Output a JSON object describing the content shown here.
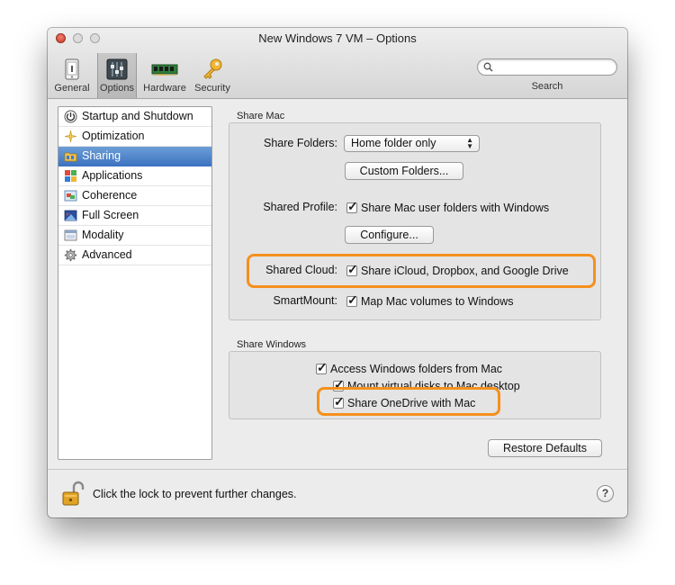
{
  "window": {
    "title": "New Windows 7 VM – Options"
  },
  "toolbar": {
    "items": [
      {
        "label": "General",
        "icon": "phone-device-icon"
      },
      {
        "label": "Options",
        "icon": "sliders-icon",
        "active": true
      },
      {
        "label": "Hardware",
        "icon": "memory-chip-icon"
      },
      {
        "label": "Security",
        "icon": "key-icon"
      }
    ],
    "search_label": "Search",
    "search_value": ""
  },
  "sidebar": {
    "items": [
      {
        "label": "Startup and Shutdown",
        "icon": "power-icon"
      },
      {
        "label": "Optimization",
        "icon": "sparkle-icon"
      },
      {
        "label": "Sharing",
        "icon": "sharing-folder-icon",
        "selected": true
      },
      {
        "label": "Applications",
        "icon": "applications-icon"
      },
      {
        "label": "Coherence",
        "icon": "coherence-icon"
      },
      {
        "label": "Full Screen",
        "icon": "full-screen-icon"
      },
      {
        "label": "Modality",
        "icon": "modality-icon"
      },
      {
        "label": "Advanced",
        "icon": "gear-icon"
      }
    ]
  },
  "share_mac": {
    "section_label": "Share Mac",
    "share_folders_label": "Share Folders:",
    "share_folders_value": "Home folder only",
    "custom_folders_button": "Custom Folders...",
    "shared_profile_label": "Shared Profile:",
    "shared_profile_checkbox": {
      "label": "Share Mac user folders with Windows",
      "checked": true
    },
    "configure_button": "Configure...",
    "shared_cloud_label": "Shared Cloud:",
    "shared_cloud_checkbox": {
      "label": "Share iCloud, Dropbox, and Google Drive",
      "checked": true
    },
    "smartmount_label": "SmartMount:",
    "smartmount_checkbox": {
      "label": "Map Mac volumes to Windows",
      "checked": true
    }
  },
  "share_windows": {
    "section_label": "Share Windows",
    "access_checkbox": {
      "label": "Access Windows folders from Mac",
      "checked": true
    },
    "mount_checkbox": {
      "label": "Mount virtual disks to Mac desktop",
      "checked": true
    },
    "onedrive_checkbox": {
      "label": "Share OneDrive with Mac",
      "checked": true
    }
  },
  "restore_defaults_button": "Restore Defaults",
  "lock_text": "Click the lock to prevent further changes.",
  "help_label": "?",
  "colors": {
    "highlight": "#f5901e",
    "selection": "#3d74c2"
  }
}
